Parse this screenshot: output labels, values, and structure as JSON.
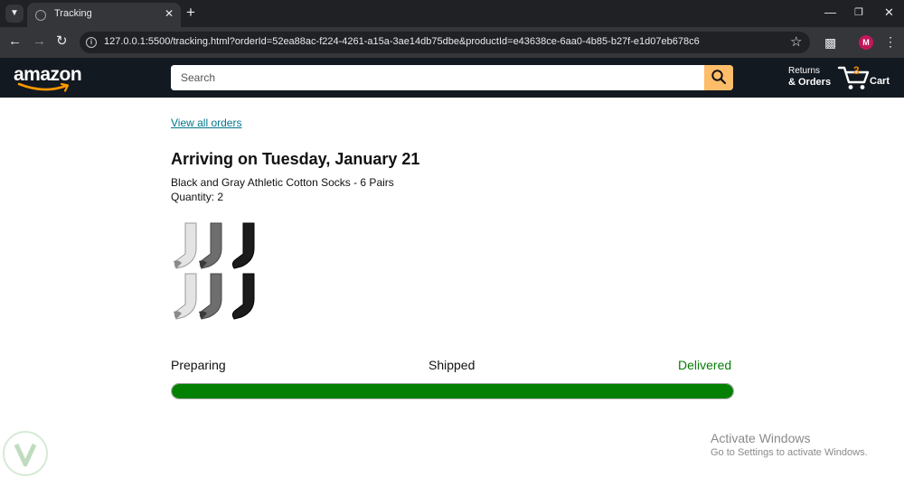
{
  "browser": {
    "tab_title": "Tracking",
    "url": "127.0.0.1:5500/tracking.html?orderId=52ea88ac-f224-4261-a15a-3ae14db75dbe&productId=e43638ce-6aa0-4b85-b27f-e1d07eb678c6",
    "profile_initial": "M"
  },
  "header": {
    "logo_text": "amazon",
    "search_placeholder": "Search",
    "returns_line1": "Returns",
    "returns_line2": "& Orders",
    "cart_count": "3",
    "cart_label": "Cart"
  },
  "tracking": {
    "view_all_orders": "View all orders",
    "arriving": "Arriving on Tuesday, January 21",
    "product_name": "Black and Gray Athletic Cotton Socks - 6 Pairs",
    "quantity": "Quantity: 2",
    "progress": {
      "labels": [
        "Preparing",
        "Shipped",
        "Delivered"
      ],
      "current": "Delivered",
      "fill_fraction": 1.0
    }
  },
  "watermark": {
    "title": "Activate Windows",
    "subtitle": "Go to Settings to activate Windows."
  },
  "colors": {
    "header_bg": "#131921",
    "search_button": "#febd69",
    "link": "#01768b",
    "delivered": "#067d06",
    "progress_fill": "#048004"
  }
}
